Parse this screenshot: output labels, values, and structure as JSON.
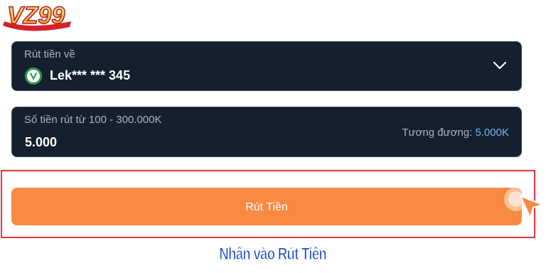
{
  "brand": {
    "logo_text": "VZ99"
  },
  "withdraw_destination": {
    "label": "Rút tiền về",
    "account": "Lek*** *** 345",
    "bank_icon": "bank-logo-icon",
    "dropdown_icon": "chevron-down-icon"
  },
  "amount": {
    "label": "Số tiền rút từ 100 - 300.000K",
    "value": "5.000",
    "equivalent_label": "Tương đương: ",
    "equivalent_value": "5.000K"
  },
  "actions": {
    "withdraw_label": "Rút Tiền"
  },
  "caption": "Nhấn vào Rút Tiền",
  "colors": {
    "field_bg": "#14202d",
    "button": "#f98a42",
    "highlight": "#e8323a",
    "caption": "#1f4fc6",
    "equivalent_value": "#6fb4f2"
  }
}
